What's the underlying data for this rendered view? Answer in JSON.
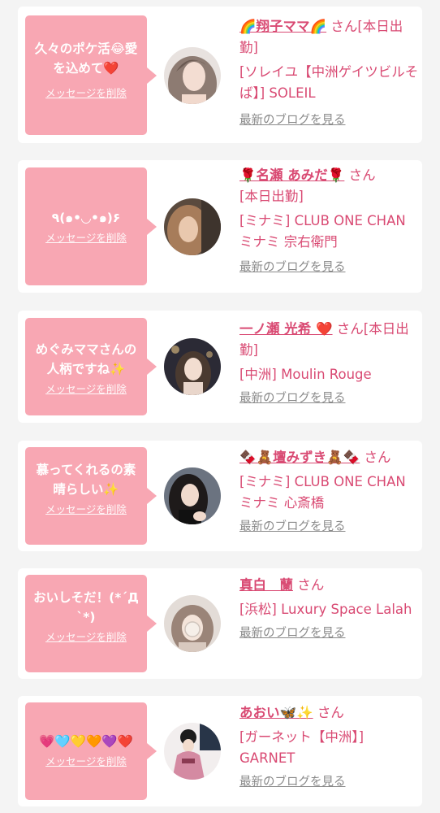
{
  "cards": [
    {
      "message": "久々のポケ活😂愛\nを込めて❤️",
      "delete_label": "メッセージを削除",
      "name": "🌈翔子ママ🌈",
      "honorific": "さん",
      "status": "[本日出勤]",
      "shop": "[ソレイユ【中洲ゲイツビルそば】] SOLEIL",
      "blog_link": "最新のブログを見る",
      "avatar": "avatar-shoko"
    },
    {
      "message": "٩(๑•◡•๑)۶",
      "delete_label": "メッセージを削除",
      "name": "🌹名瀬 あみだ🌹",
      "honorific": "さん",
      "status": "[本日出勤]",
      "shop": "[ミナミ] CLUB ONE CHAN ミナミ 宗右衛門",
      "blog_link": "最新のブログを見る",
      "avatar": "avatar-amida"
    },
    {
      "message": "めぐみママさんの\n人柄ですね✨",
      "delete_label": "メッセージを削除",
      "name": "一ノ瀬 光希 ❤️",
      "honorific": "さん",
      "status": "[本日出勤]",
      "shop": "[中洲] Moulin Rouge",
      "blog_link": "最新のブログを見る",
      "avatar": "avatar-kouki"
    },
    {
      "message": "慕ってくれるの素\n晴らしい✨",
      "delete_label": "メッセージを削除",
      "name": "🍫🧸壇みずき🧸🍫",
      "honorific": "さん",
      "status": "",
      "shop": "[ミナミ] CLUB ONE CHAN ミナミ 心斎橋",
      "blog_link": "最新のブログを見る",
      "avatar": "avatar-mizuki"
    },
    {
      "message": "おいしそだ！(*´Д\n`*)",
      "delete_label": "メッセージを削除",
      "name": "真白　蘭",
      "honorific": "さん",
      "status": "",
      "shop": "[浜松] Luxury Space Lalah",
      "blog_link": "最新のブログを見る",
      "avatar": "avatar-ran"
    },
    {
      "message": "💗🩵💛🧡💜❤️",
      "delete_label": "メッセージを削除",
      "name": "あおい🦋✨",
      "honorific": "さん",
      "status": "",
      "shop": "[ガーネット【中洲】] GARNET",
      "blog_link": "最新のブログを見る",
      "avatar": "avatar-aoi"
    }
  ]
}
